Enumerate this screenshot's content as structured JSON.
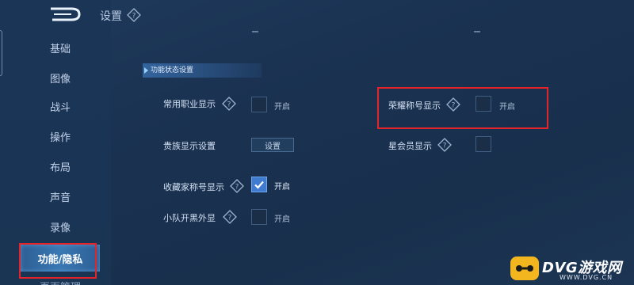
{
  "header": {
    "title": "设置"
  },
  "sidebar": {
    "items": [
      {
        "label": "基础"
      },
      {
        "label": "图像"
      },
      {
        "label": "战斗"
      },
      {
        "label": "操作"
      },
      {
        "label": "布局"
      },
      {
        "label": "声音"
      },
      {
        "label": "录像"
      },
      {
        "label": "功能/隐私"
      },
      {
        "label": "页面管理"
      }
    ],
    "active_index": 7
  },
  "section": {
    "title": "功能状态设置"
  },
  "settings": {
    "career": {
      "label": "常用职业显示",
      "checked": false,
      "state": "开启"
    },
    "noble": {
      "label": "贵族显示设置",
      "button": "设置"
    },
    "collector": {
      "label": "收藏家称号显示",
      "checked": true,
      "state": "开启"
    },
    "squad": {
      "label": "小队开黑外显",
      "checked": false,
      "state": "开启"
    },
    "honor": {
      "label": "荣耀称号显示",
      "checked": false,
      "state": "开启"
    },
    "star": {
      "label": "星会员显示",
      "checked": false,
      "state": ""
    }
  },
  "watermark": {
    "text": "DVG游戏网",
    "sub": "WWW.DVG.CN"
  },
  "colors": {
    "accent": "#3f7cd0",
    "highlight": "#e3242b",
    "watermark": "#f3b61f"
  }
}
